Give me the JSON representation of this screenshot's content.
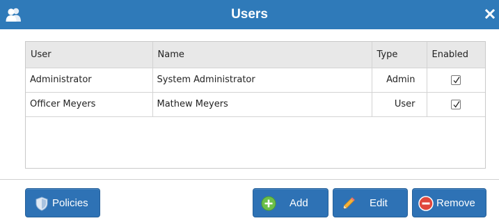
{
  "window": {
    "title": "Users",
    "title_icon": "users-icon",
    "close_icon": "close-icon",
    "titlebar_color": "#2f7ab9"
  },
  "table": {
    "columns": [
      "User",
      "Name",
      "Type",
      "Enabled"
    ],
    "rows": [
      {
        "user": "Administrator",
        "name": "System Administrator",
        "type": "Admin",
        "enabled": true
      },
      {
        "user": "Officer Meyers",
        "name": "Mathew Meyers",
        "type": "User",
        "enabled": true
      }
    ]
  },
  "buttons": {
    "policies": {
      "label": "Policies",
      "icon": "shield-icon"
    },
    "add": {
      "label": "Add",
      "icon": "plus-circle-icon"
    },
    "edit": {
      "label": "Edit",
      "icon": "pencil-icon"
    },
    "remove": {
      "label": "Remove",
      "icon": "minus-circle-icon"
    }
  },
  "colors": {
    "button": "#2e72b5",
    "add_icon": "#6cc04a",
    "remove_icon": "#e0473c",
    "edit_icon": "#f3b23a"
  }
}
